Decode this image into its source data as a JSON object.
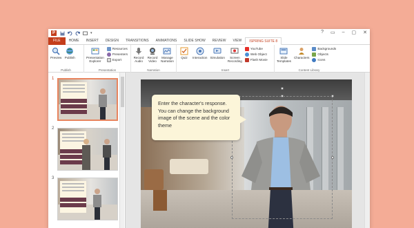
{
  "app": {
    "icon_letter": "P"
  },
  "window": {
    "controls": [
      "?",
      "▭",
      "–",
      "▢",
      "✕"
    ]
  },
  "qat": {
    "save_icon": "save-icon",
    "undo_icon": "undo-icon",
    "redo_icon": "redo-icon"
  },
  "tabs": [
    "FILE",
    "HOME",
    "INSERT",
    "DESIGN",
    "TRANSITIONS",
    "ANIMATIONS",
    "SLIDE SHOW",
    "REVIEW",
    "VIEW",
    "ISPRING SUITE 8"
  ],
  "active_tab": "ISPRING SUITE 8",
  "ribbon": {
    "publish": {
      "label": "Publish",
      "preview": "Preview",
      "publish_btn": "Publish"
    },
    "presentation": {
      "label": "Presentation",
      "explorer": "Presentation\nExplorer",
      "resources": "Resources",
      "presenters": "Presenters",
      "export": "Export"
    },
    "narration": {
      "label": "Narration",
      "record_audio": "Record\nAudio",
      "record_video": "Record\nVideo",
      "manage": "Manage\nNarration"
    },
    "insert": {
      "label": "Insert",
      "quiz": "Quiz",
      "interaction": "Interaction",
      "simulation": "Simulation",
      "screen_recording": "Screen\nRecording",
      "youtube": "YouTube",
      "web_object": "Web Object",
      "flash_movie": "Flash Movie"
    },
    "content_library": {
      "label": "Content Library",
      "slide_templates": "Slide\nTemplates",
      "characters": "Characters",
      "backgrounds": "Backgrounds",
      "objects": "Objects",
      "icons": "Icons"
    }
  },
  "slides": [
    {
      "number": "1",
      "selected": true
    },
    {
      "number": "2",
      "selected": false
    },
    {
      "number": "3",
      "selected": false
    }
  ],
  "main_slide": {
    "bubble_text": "Enter the character's response. You can change the background image of the scene and the color theme"
  },
  "colors": {
    "background": "#f4ac96",
    "accent": "#c43e1c",
    "bubble": "#fcf5d9"
  }
}
